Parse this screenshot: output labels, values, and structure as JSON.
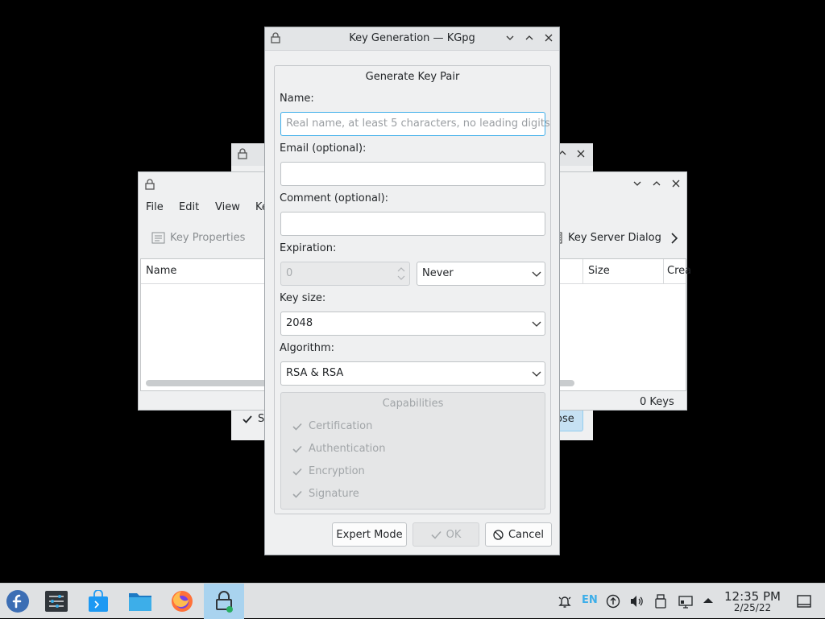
{
  "background_windows": {
    "main": {
      "menu": [
        "File",
        "Edit",
        "View",
        "Ke"
      ],
      "toolbar": {
        "key_properties": "Key Properties",
        "key_server_dialog": "Key Server Dialog"
      },
      "columns": {
        "name": "Name",
        "size": "Size",
        "created": "Crea"
      },
      "status": "0 Keys"
    },
    "secondary": {
      "checkbox_label": "S",
      "close_label": "ose"
    }
  },
  "dialog": {
    "title": "Key Generation — KGpg",
    "group_title": "Generate Key Pair",
    "name_label": "Name:",
    "name_placeholder": "Real name, at least 5 characters, no leading digits",
    "email_label": "Email (optional):",
    "comment_label": "Comment (optional):",
    "expiration_label": "Expiration:",
    "expiration_value": "0",
    "expiration_unit": "Never",
    "key_size_label": "Key size:",
    "key_size_value": "2048",
    "algorithm_label": "Algorithm:",
    "algorithm_value": "RSA & RSA",
    "capabilities": {
      "title": "Capabilities",
      "items": [
        "Certification",
        "Authentication",
        "Encryption",
        "Signature"
      ]
    },
    "buttons": {
      "expert": "Expert Mode",
      "ok": "OK",
      "cancel": "Cancel"
    }
  },
  "taskbar": {
    "language": "EN",
    "time": "12:35 PM",
    "date": "2/25/22"
  },
  "colors": {
    "accent": "#3daee9",
    "active_task": "#a9d3ef"
  }
}
